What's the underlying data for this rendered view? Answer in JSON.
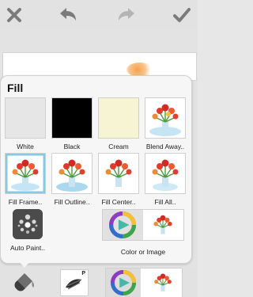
{
  "toolbar": {
    "close_icon": "close-icon",
    "undo_icon": "undo-icon",
    "redo_icon": "redo-icon",
    "done_icon": "checkmark-icon"
  },
  "fill_panel": {
    "title": "Fill",
    "options": [
      {
        "label": "White",
        "type": "color",
        "color": "#e6e6e6"
      },
      {
        "label": "Black",
        "type": "color",
        "color": "#000000"
      },
      {
        "label": "Cream",
        "type": "color",
        "color": "#f6f4d2"
      },
      {
        "label": "Blend Away..",
        "type": "image"
      },
      {
        "label": "Fill Frame..",
        "type": "image"
      },
      {
        "label": "Fill Outline..",
        "type": "image"
      },
      {
        "label": "Fill Center..",
        "type": "image"
      },
      {
        "label": "Fill All..",
        "type": "image"
      }
    ],
    "auto_paint_label": "Auto Paint..",
    "color_or_image_label": "Color or Image"
  },
  "bottom_bar": {
    "bucket_icon": "paint-bucket-icon",
    "brush_badge": "P",
    "brush_icon": "brush-icon",
    "color_wheel_icon": "color-wheel-icon"
  },
  "colors": {
    "accent_green": "#46b9a4",
    "toolbar_icon": "#7b7b7b"
  }
}
